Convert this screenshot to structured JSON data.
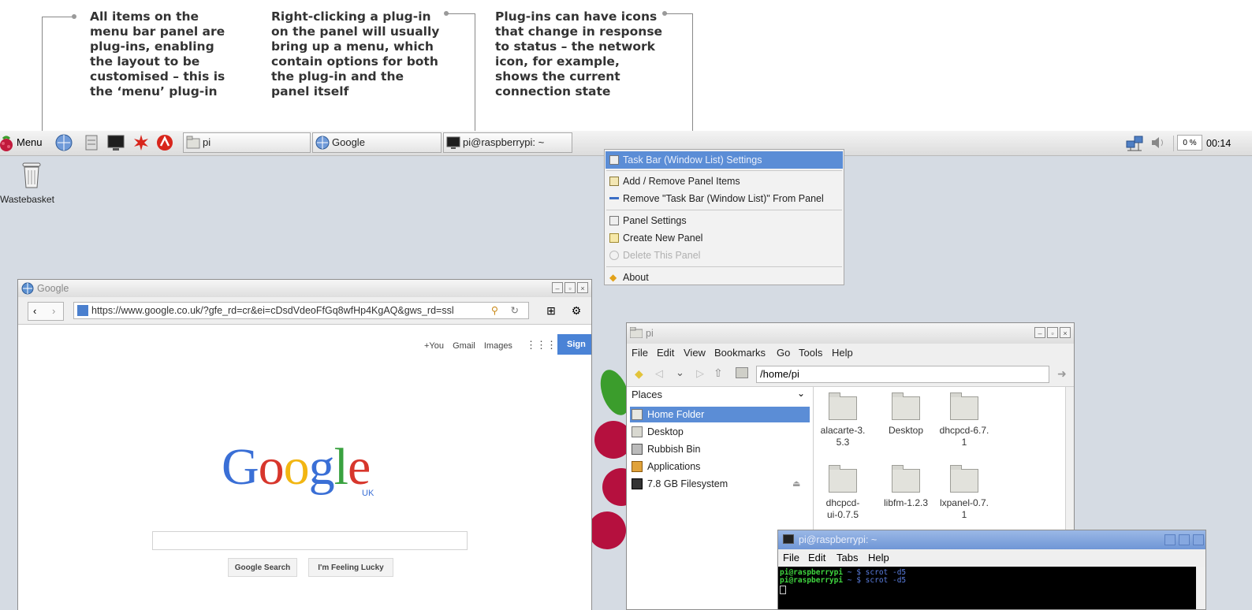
{
  "annotations": {
    "a1": [
      "All items on the",
      "menu bar panel are",
      "plug-ins, enabling",
      "the layout to be",
      "customised – this is",
      "the ‘menu’ plug-in"
    ],
    "a2": [
      "Right-clicking a plug-in",
      "on the panel will usually",
      "bring up a menu, which",
      "contain options for both",
      "the plug-in and the",
      "panel itself"
    ],
    "a3": [
      "Plug-ins can have icons",
      "that change in response",
      "to status – the network",
      "icon, for example,",
      "shows the current",
      "connection state"
    ]
  },
  "panel": {
    "menu_label": "Menu",
    "tasks": [
      {
        "label": "pi",
        "icon": "folder-icon"
      },
      {
        "label": "Google",
        "icon": "globe-icon"
      },
      {
        "label": "pi@raspberrypi: ~",
        "icon": "terminal-icon"
      }
    ],
    "cpu": "0 %",
    "clock": "00:14"
  },
  "desktop": {
    "wastebasket_label": "Wastebasket"
  },
  "context_menu": {
    "items": [
      "Task Bar (Window List) Settings",
      "Add / Remove Panel Items",
      "Remove \"Task Bar (Window List)\" From Panel",
      "Panel Settings",
      "Create New Panel",
      "Delete This Panel",
      "About"
    ]
  },
  "browser": {
    "title": "Google",
    "url": "https://www.google.co.uk/?gfe_rd=cr&ei=cDsdVdeoFfGq8wfHp4KgAQ&gws_rd=ssl",
    "links": [
      "+You",
      "Gmail",
      "Images"
    ],
    "sign_in": "Sign",
    "logo": "Google",
    "logo_sub": "UK",
    "search_btn": "Google Search",
    "lucky_btn": "I'm Feeling Lucky"
  },
  "filemanager": {
    "title": "pi",
    "menu": [
      "File",
      "Edit",
      "View",
      "Bookmarks",
      "Go",
      "Tools",
      "Help"
    ],
    "path": "/home/pi",
    "places_header": "Places",
    "places": [
      "Home Folder",
      "Desktop",
      "Rubbish Bin",
      "Applications",
      "7.8 GB Filesystem"
    ],
    "files": [
      [
        "alacarte-3.",
        "5.3"
      ],
      [
        "Desktop"
      ],
      [
        "dhcpcd-6.7.",
        "1"
      ],
      [
        "dhcpcd-",
        "ui-0.7.5"
      ],
      [
        "libfm-1.2.3"
      ],
      [
        "lxpanel-0.7.",
        "1"
      ]
    ]
  },
  "terminal": {
    "title": "pi@raspberrypi: ~",
    "menu": [
      "File",
      "Edit",
      "Tabs",
      "Help"
    ],
    "lines": [
      {
        "prompt": "pi@raspberrypi",
        "rest": " ~ $ scrot -d5"
      },
      {
        "prompt": "pi@raspberrypi",
        "rest": " ~ $ scrot -d5"
      }
    ]
  },
  "colors": {
    "accent_selected": "#5b8dd6",
    "desktop_bg": "#d5dbe3",
    "terminal_prompt": "#3fd43f"
  }
}
